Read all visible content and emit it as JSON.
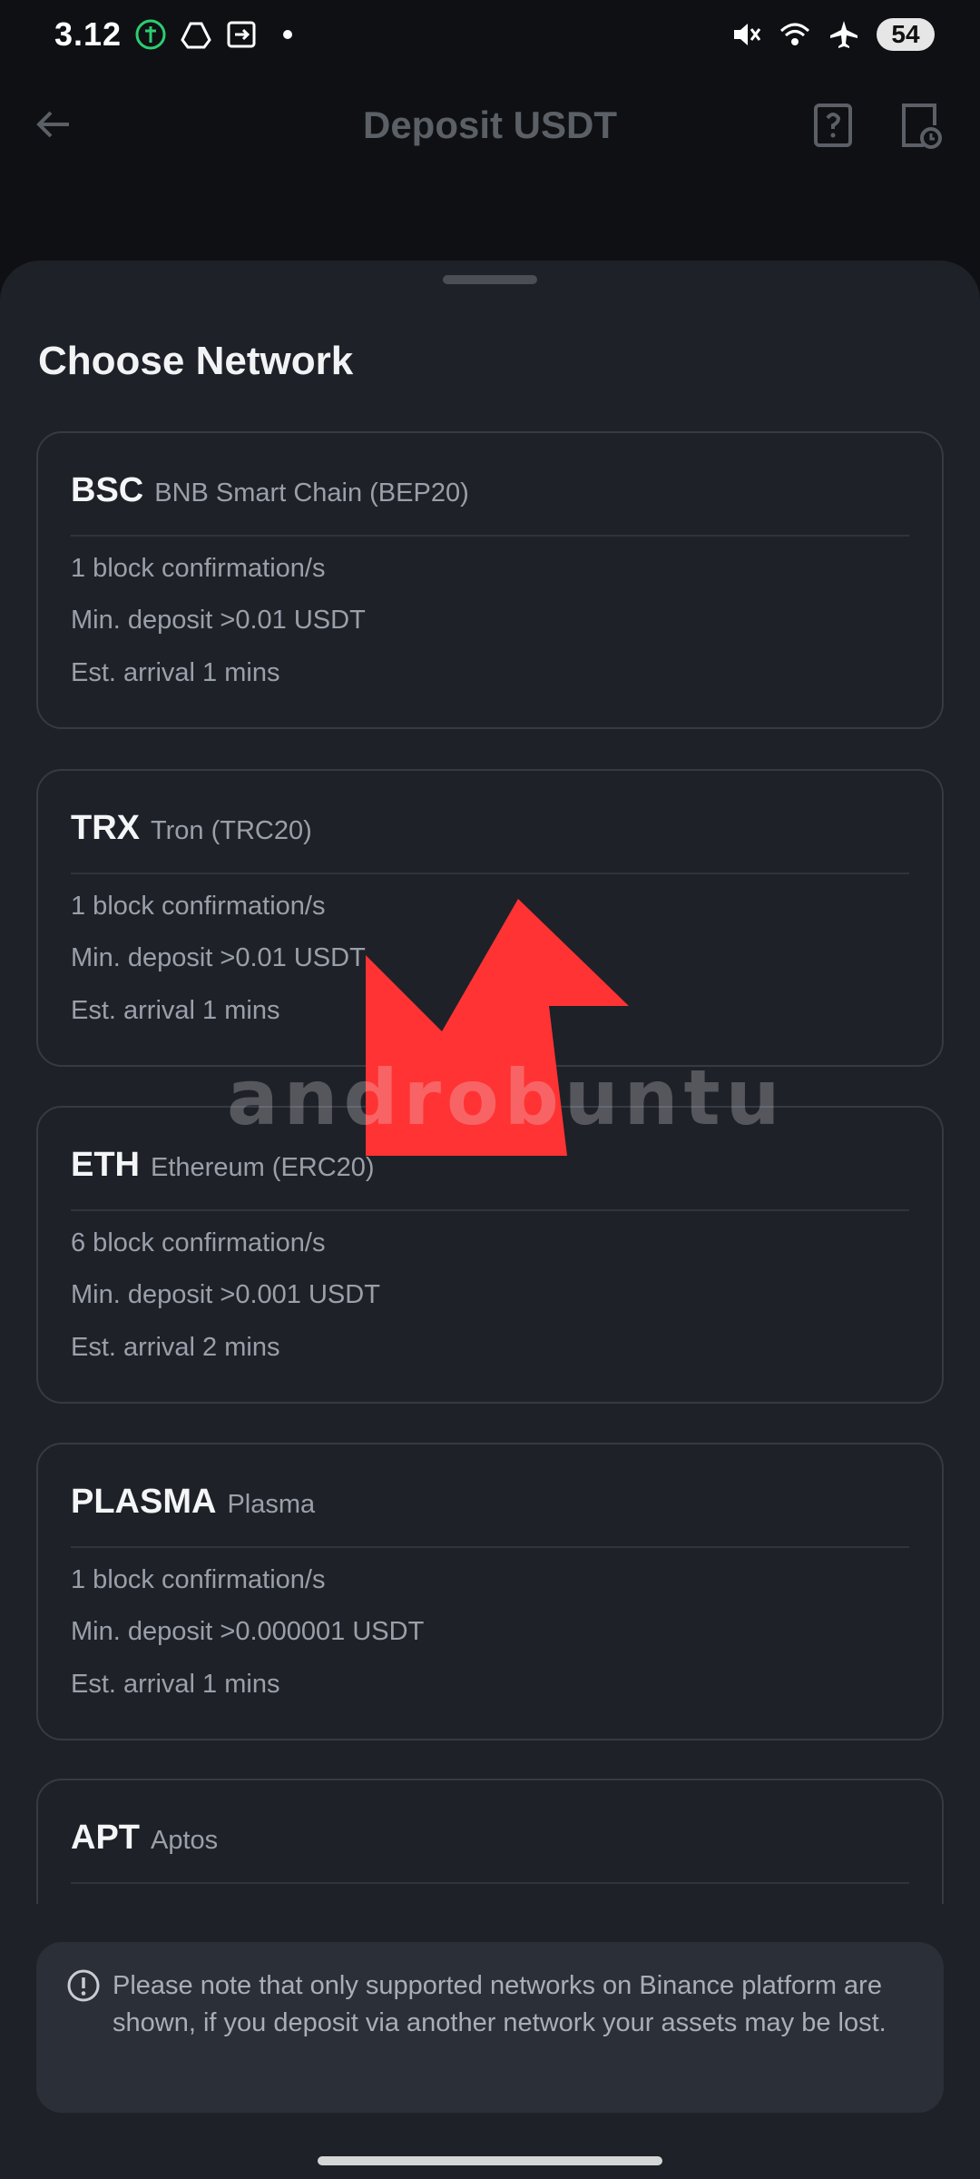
{
  "status_bar": {
    "time": "3.12",
    "battery": "54",
    "icons": [
      "wallet-icon",
      "drive-icon",
      "cast-icon",
      "mute-icon",
      "wifi-icon",
      "airplane-icon"
    ]
  },
  "header": {
    "title": "Deposit USDT"
  },
  "sheet": {
    "title": "Choose Network",
    "networks": [
      {
        "code": "BSC",
        "name": "BNB Smart Chain (BEP20)",
        "confirmations": "1 block confirmation/s",
        "min_deposit": "Min. deposit >0.01 USDT",
        "arrival": "Est. arrival 1 mins"
      },
      {
        "code": "TRX",
        "name": "Tron (TRC20)",
        "confirmations": "1 block confirmation/s",
        "min_deposit": "Min. deposit >0.01 USDT",
        "arrival": "Est. arrival 1 mins"
      },
      {
        "code": "ETH",
        "name": "Ethereum (ERC20)",
        "confirmations": "6 block confirmation/s",
        "min_deposit": "Min. deposit >0.001 USDT",
        "arrival": "Est. arrival 2 mins"
      },
      {
        "code": "PLASMA",
        "name": "Plasma",
        "confirmations": "1 block confirmation/s",
        "min_deposit": "Min. deposit >0.000001 USDT",
        "arrival": "Est. arrival 1 mins"
      },
      {
        "code": "APT",
        "name": "Aptos",
        "confirmations": "",
        "min_deposit": "",
        "arrival": ""
      }
    ],
    "notice": "Please note that only supported networks on Binance platform are shown, if you deposit via another network your assets may be lost."
  },
  "overlay": {
    "watermark": "androbuntu",
    "arrow_color": "#ff3333"
  }
}
